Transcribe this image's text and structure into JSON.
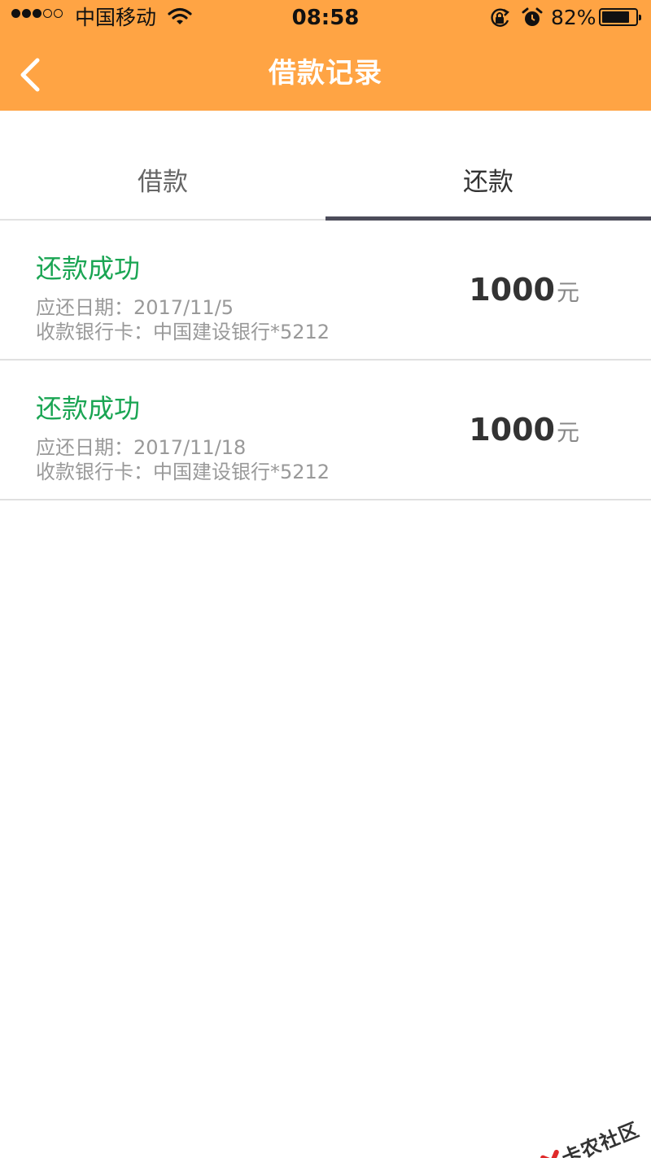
{
  "status_bar": {
    "carrier": "中国移动",
    "time": "08:58",
    "battery": "82%",
    "battery_level": 0.82,
    "signal_strength": 3,
    "icons": [
      "signal-dots-icon",
      "wifi-icon",
      "rotation-lock-icon",
      "alarm-icon",
      "battery-icon"
    ]
  },
  "nav": {
    "title": "借款记录",
    "back_icon": "chevron-left-icon"
  },
  "tabs": [
    {
      "label": "借款",
      "active": false
    },
    {
      "label": "还款",
      "active": true
    }
  ],
  "records": [
    {
      "status": "还款成功",
      "due_label": "应还日期：",
      "due_date": "2017/11/5",
      "card_label": "收款银行卡：",
      "card": "中国建设银行*5212",
      "amount": "1000",
      "unit": "元"
    },
    {
      "status": "还款成功",
      "due_label": "应还日期：",
      "due_date": "2017/11/18",
      "card_label": "收款银行卡：",
      "card": "中国建设银行*5212",
      "amount": "1000",
      "unit": "元"
    }
  ],
  "watermark": {
    "text": "卡农社区"
  },
  "colors": {
    "header": "#FFA444",
    "status_success": "#1aa553",
    "tab_indicator": "#4c4c5a"
  }
}
